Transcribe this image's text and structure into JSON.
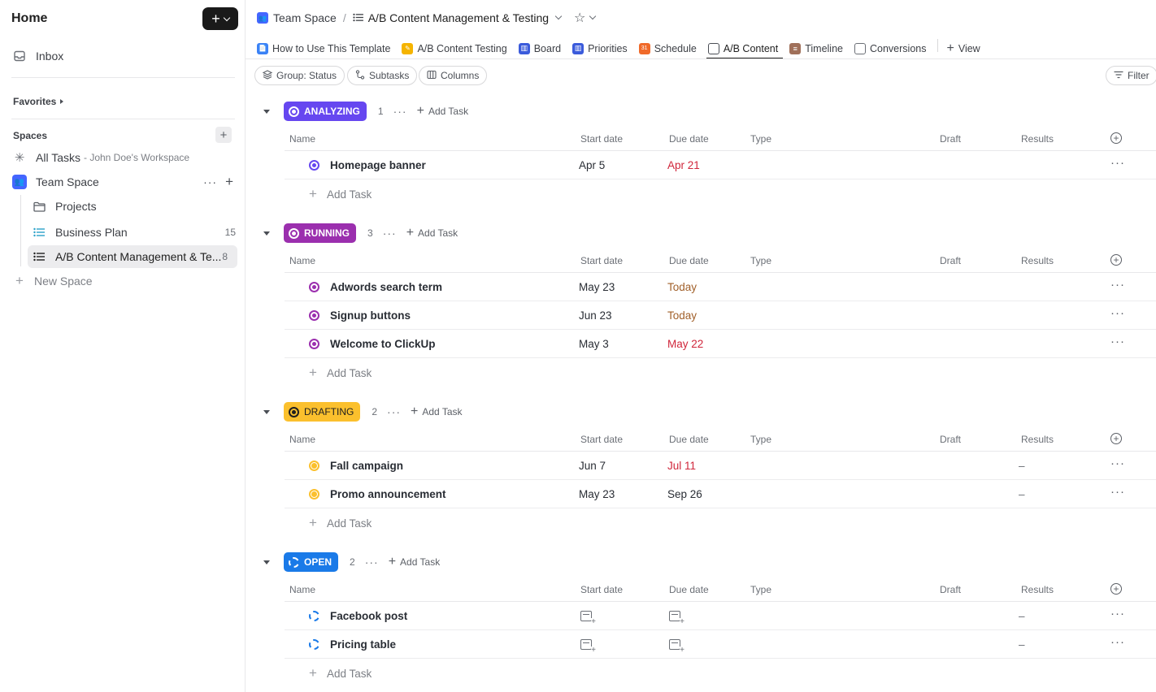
{
  "sidebar": {
    "home": "Home",
    "inbox": "Inbox",
    "favorites": "Favorites",
    "spaces": "Spaces",
    "all_tasks": "All Tasks",
    "all_tasks_sub": "- John Doe's Workspace",
    "team_space": "Team Space",
    "items": [
      {
        "label": "Projects",
        "count": ""
      },
      {
        "label": "Business Plan",
        "count": "15"
      },
      {
        "label": "A/B Content Management & Te...",
        "count": "8"
      }
    ],
    "new_space": "New Space"
  },
  "breadcrumb": {
    "space": "Team Space",
    "list": "A/B Content Management & Testing"
  },
  "tabs": [
    {
      "label": "How to Use This Template"
    },
    {
      "label": "A/B Content Testing"
    },
    {
      "label": "Board"
    },
    {
      "label": "Priorities"
    },
    {
      "label": "Schedule"
    },
    {
      "label": "A/B Content"
    },
    {
      "label": "Timeline"
    },
    {
      "label": "Conversions"
    },
    {
      "label": "View"
    }
  ],
  "toolbar": {
    "group": "Group: Status",
    "subtasks": "Subtasks",
    "columns": "Columns",
    "filter": "Filter"
  },
  "columns": {
    "name": "Name",
    "start": "Start date",
    "due": "Due date",
    "type": "Type",
    "draft": "Draft",
    "results": "Results"
  },
  "add_task": "Add Task",
  "groups": [
    {
      "status": "ANALYZING",
      "count": "1",
      "color": "#6647f0",
      "tasks": [
        {
          "name": "Homepage banner",
          "start": "Apr 5",
          "due": "Apr 21",
          "results": ""
        }
      ]
    },
    {
      "status": "RUNNING",
      "count": "3",
      "color": "#9b2fae",
      "tasks": [
        {
          "name": "Adwords search term",
          "start": "May 23",
          "due": "Today",
          "results": ""
        },
        {
          "name": "Signup buttons",
          "start": "Jun 23",
          "due": "Today",
          "results": ""
        },
        {
          "name": "Welcome to ClickUp",
          "start": "May 3",
          "due": "May 22",
          "results": ""
        }
      ]
    },
    {
      "status": "DRAFTING",
      "count": "2",
      "color": "#fbc02d",
      "tasks": [
        {
          "name": "Fall campaign",
          "start": "Jun 7",
          "due": "Jul 11",
          "results": "–"
        },
        {
          "name": "Promo announcement",
          "start": "May 23",
          "due": "Sep 26",
          "results": "–"
        }
      ]
    },
    {
      "status": "OPEN",
      "count": "2",
      "color": "#1a7ae8",
      "tasks": [
        {
          "name": "Facebook post",
          "start": "",
          "due": "",
          "results": "–"
        },
        {
          "name": "Pricing table",
          "start": "",
          "due": "",
          "results": "–"
        }
      ]
    }
  ]
}
